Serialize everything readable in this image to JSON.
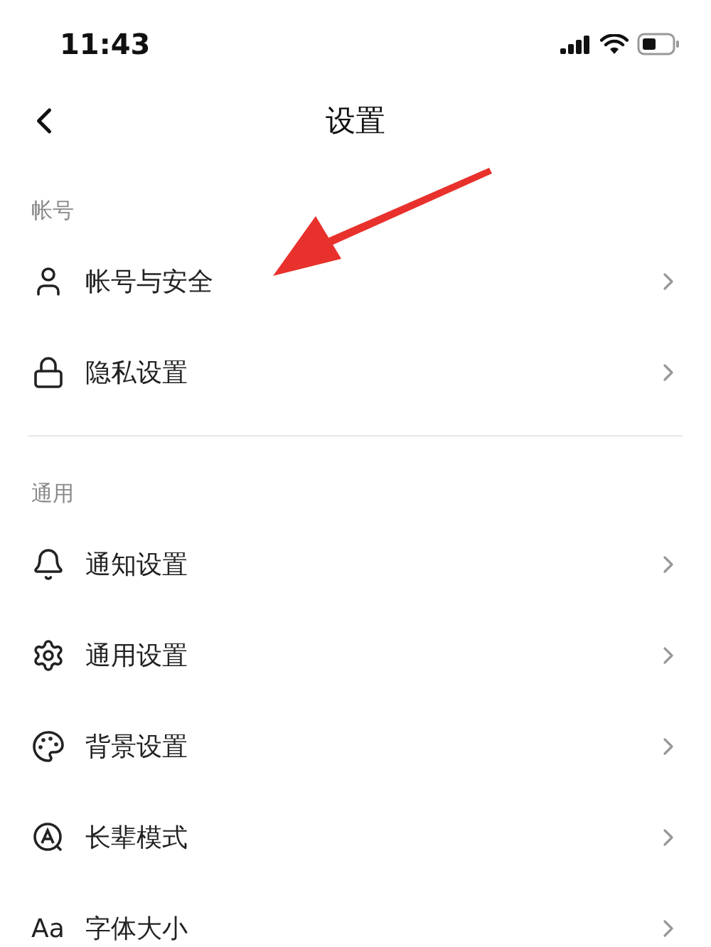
{
  "status_bar": {
    "time": "11:43"
  },
  "nav": {
    "title": "设置"
  },
  "sections": [
    {
      "header": "帐号",
      "items": [
        {
          "label": "帐号与安全",
          "kind": "user"
        },
        {
          "label": "隐私设置",
          "kind": "lock"
        }
      ]
    },
    {
      "header": "通用",
      "items": [
        {
          "label": "通知设置",
          "kind": "bell"
        },
        {
          "label": "通用设置",
          "kind": "gear"
        },
        {
          "label": "背景设置",
          "kind": "palette"
        },
        {
          "label": "长辈模式",
          "kind": "elder"
        },
        {
          "label": "字体大小",
          "kind": "font",
          "icon_text": "Aa"
        }
      ]
    }
  ],
  "annotation": {
    "kind": "arrow"
  }
}
